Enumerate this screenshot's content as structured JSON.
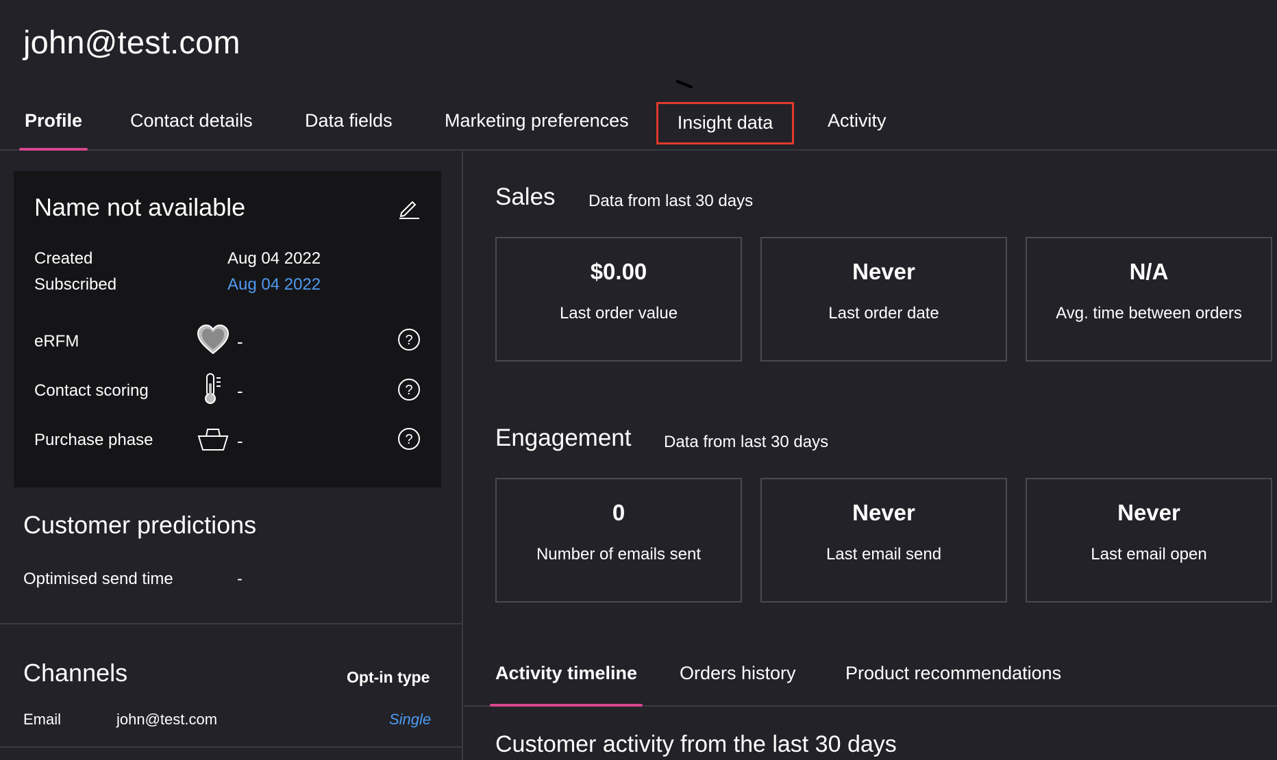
{
  "header": {
    "title": "john@test.com"
  },
  "top_tabs": [
    {
      "label": "Profile",
      "active": true
    },
    {
      "label": "Contact details"
    },
    {
      "label": "Data fields"
    },
    {
      "label": "Marketing preferences"
    },
    {
      "label": "Insight data",
      "highlighted": true
    },
    {
      "label": "Activity"
    }
  ],
  "profile_card": {
    "name": "Name not available",
    "created_label": "Created",
    "created_value": "Aug 04 2022",
    "subscribed_label": "Subscribed",
    "subscribed_value": "Aug 04 2022",
    "metrics": [
      {
        "label": "eRFM",
        "icon": "heart-icon",
        "value": "-"
      },
      {
        "label": "Contact scoring",
        "icon": "thermometer-icon",
        "value": "-"
      },
      {
        "label": "Purchase phase",
        "icon": "basket-icon",
        "value": "-"
      }
    ]
  },
  "predictions": {
    "title": "Customer predictions",
    "send_time_label": "Optimised send time",
    "send_time_value": "-"
  },
  "channels": {
    "title": "Channels",
    "optin_header": "Opt-in type",
    "rows": [
      {
        "label": "Email",
        "value": "john@test.com",
        "optin": "Single"
      }
    ]
  },
  "sales": {
    "title": "Sales",
    "subtitle": "Data from last 30 days",
    "cards": [
      {
        "value": "$0.00",
        "label": "Last order value"
      },
      {
        "value": "Never",
        "label": "Last order date"
      },
      {
        "value": "N/A",
        "label": "Avg. time between orders"
      }
    ]
  },
  "engagement": {
    "title": "Engagement",
    "subtitle": "Data from last 30 days",
    "cards": [
      {
        "value": "0",
        "label": "Number of emails sent"
      },
      {
        "value": "Never",
        "label": "Last email send"
      },
      {
        "value": "Never",
        "label": "Last email open"
      }
    ]
  },
  "sub_tabs": [
    {
      "label": "Activity timeline",
      "active": true
    },
    {
      "label": "Orders history"
    },
    {
      "label": "Product recommendations"
    }
  ],
  "timeline": {
    "title": "Customer activity from the last 30 days"
  },
  "colors": {
    "accent": "#d5478c",
    "link": "#4f9bf0",
    "highlight": "#e03a2c",
    "background": "#222228",
    "card": "#151518"
  }
}
